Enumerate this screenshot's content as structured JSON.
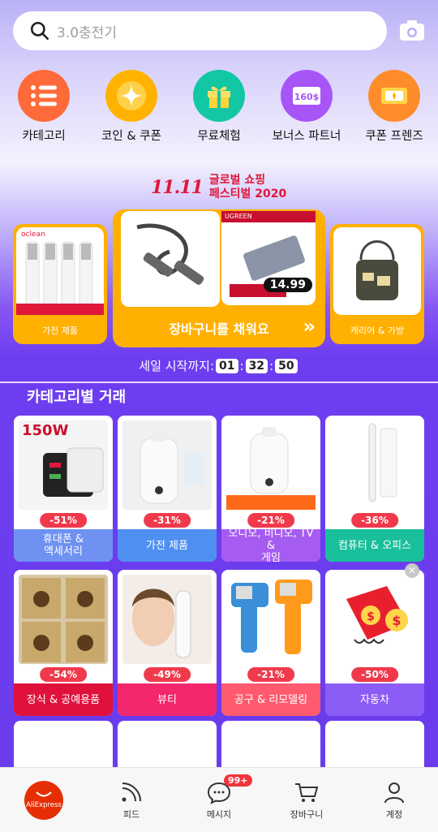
{
  "search": {
    "placeholder": "3.0충전기"
  },
  "quick": [
    {
      "label": "카테고리",
      "icon": "category-list-icon",
      "color": "#ff6f3c"
    },
    {
      "label": "코인 & 쿠폰",
      "icon": "coin-star-icon",
      "color": "#ffb300"
    },
    {
      "label": "무료체험",
      "icon": "gift-box-icon",
      "color": "#13c7a4"
    },
    {
      "label": "보너스 파트너",
      "icon": "bonus-money-icon",
      "color": "#a855f7"
    },
    {
      "label": "쿠폰 프렌즈",
      "icon": "coupon-ticket-icon",
      "color": "#ff8c2b"
    }
  ],
  "festival": {
    "logo": "11.11",
    "line1": "글로벌 쇼핑",
    "line2": "페스티벌 2020"
  },
  "banner": {
    "left_label": "가전 제품",
    "center_cta": "장바구니를 채워요",
    "right_label": "캐리어 & 가방",
    "price": "14.99",
    "brand_left": "oclean",
    "brand_center": "UGREEN"
  },
  "timer": {
    "label": "세일 시작까지:",
    "h": "01",
    "m": "32",
    "s": "50"
  },
  "section_title": "카테고리별 거래",
  "tiles": [
    {
      "discount": "-51%",
      "name": "휴대폰 &\n액세서리",
      "color": "#6f91f2",
      "img": "charger-image",
      "tag": "150W"
    },
    {
      "discount": "-31%",
      "name": "가전 제품",
      "color": "#4f8ff2",
      "img": "humidifier-image"
    },
    {
      "discount": "-21%",
      "name": "오디오, 비디오, TV &\n게임",
      "color": "#a65cf0",
      "img": "humidifier-image"
    },
    {
      "discount": "-36%",
      "name": "컴퓨터 & 오피스",
      "color": "#18bf9a",
      "img": "stylus-image"
    },
    {
      "discount": "-54%",
      "name": "장식 & 공예용품",
      "color": "#e0123d",
      "img": "poster-image"
    },
    {
      "discount": "-49%",
      "name": "뷰티",
      "color": "#f2276d",
      "img": "beauty-image"
    },
    {
      "discount": "-21%",
      "name": "공구 & 리모델링",
      "color": "#ff5a6e",
      "img": "thermometer-image"
    },
    {
      "discount": "-50%",
      "name": "자동차",
      "color": "#8b5cf6",
      "img": "dollar-image"
    }
  ],
  "nav": [
    {
      "label": "",
      "icon": "aliexpress-logo",
      "text": "AliExpress"
    },
    {
      "label": "피드",
      "icon": "feed-icon"
    },
    {
      "label": "메시지",
      "icon": "message-icon",
      "badge": "99+"
    },
    {
      "label": "장바구니",
      "icon": "cart-icon"
    },
    {
      "label": "계정",
      "icon": "account-icon"
    }
  ]
}
